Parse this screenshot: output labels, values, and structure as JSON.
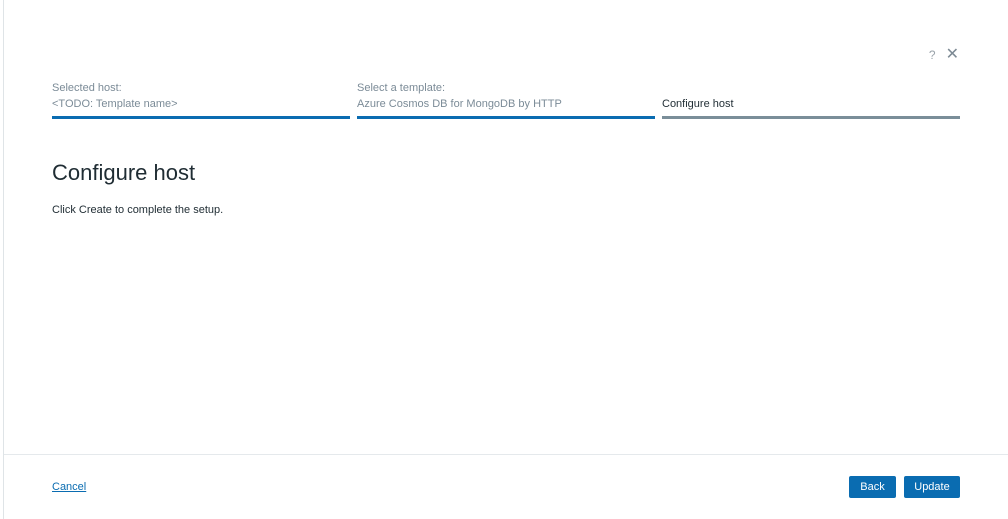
{
  "header": {
    "help_glyph": "?",
    "close_glyph": "✕"
  },
  "steps": [
    {
      "label": "Selected host:",
      "value": "<TODO: Template name>"
    },
    {
      "label": "Select a template:",
      "value": "Azure Cosmos DB for MongoDB by HTTP"
    },
    {
      "label": "",
      "value": "Configure host"
    }
  ],
  "main": {
    "title": "Configure host",
    "description": "Click Create to complete the setup."
  },
  "footer": {
    "cancel_label": "Cancel",
    "back_label": "Back",
    "update_label": "Update"
  },
  "colors": {
    "accent": "#0a6cb1",
    "current_step_bar": "#7a8e99"
  }
}
